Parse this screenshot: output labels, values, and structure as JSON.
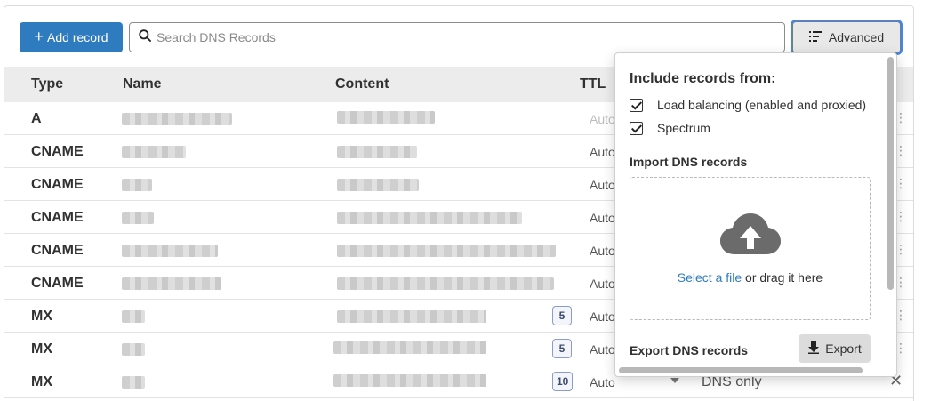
{
  "toolbar": {
    "add_label": "Add record",
    "search_placeholder": "Search DNS Records",
    "advanced_label": "Advanced"
  },
  "table": {
    "headers": {
      "type": "Type",
      "name": "Name",
      "content": "Content",
      "ttl": "TTL"
    },
    "rows": [
      {
        "type": "A",
        "ttl": "Auto",
        "priority": ""
      },
      {
        "type": "CNAME",
        "ttl": "Auto",
        "priority": ""
      },
      {
        "type": "CNAME",
        "ttl": "Auto",
        "priority": ""
      },
      {
        "type": "CNAME",
        "ttl": "Auto",
        "priority": ""
      },
      {
        "type": "CNAME",
        "ttl": "Auto",
        "priority": ""
      },
      {
        "type": "CNAME",
        "ttl": "Auto",
        "priority": ""
      },
      {
        "type": "MX",
        "ttl": "Auto",
        "priority": "5"
      },
      {
        "type": "MX",
        "ttl": "Auto",
        "priority": "5"
      },
      {
        "type": "MX",
        "ttl": "Auto",
        "priority": "10",
        "proxy_status": "DNS only"
      }
    ]
  },
  "advanced_panel": {
    "include_title": "Include records from:",
    "options": [
      {
        "label": "Load balancing (enabled and proxied)",
        "checked": true
      },
      {
        "label": "Spectrum",
        "checked": true
      }
    ],
    "import_title": "Import DNS records",
    "dropzone_link": "Select a file",
    "dropzone_text": "or drag it here",
    "export_title": "Export DNS records",
    "export_label": "Export"
  },
  "colors": {
    "accent": "#2f7bbf",
    "focus_ring": "#3b86ff"
  },
  "icons": [
    "search-icon",
    "filter-list-icon",
    "cloud-upload-icon",
    "download-icon",
    "close-icon",
    "chevron-down-icon"
  ]
}
